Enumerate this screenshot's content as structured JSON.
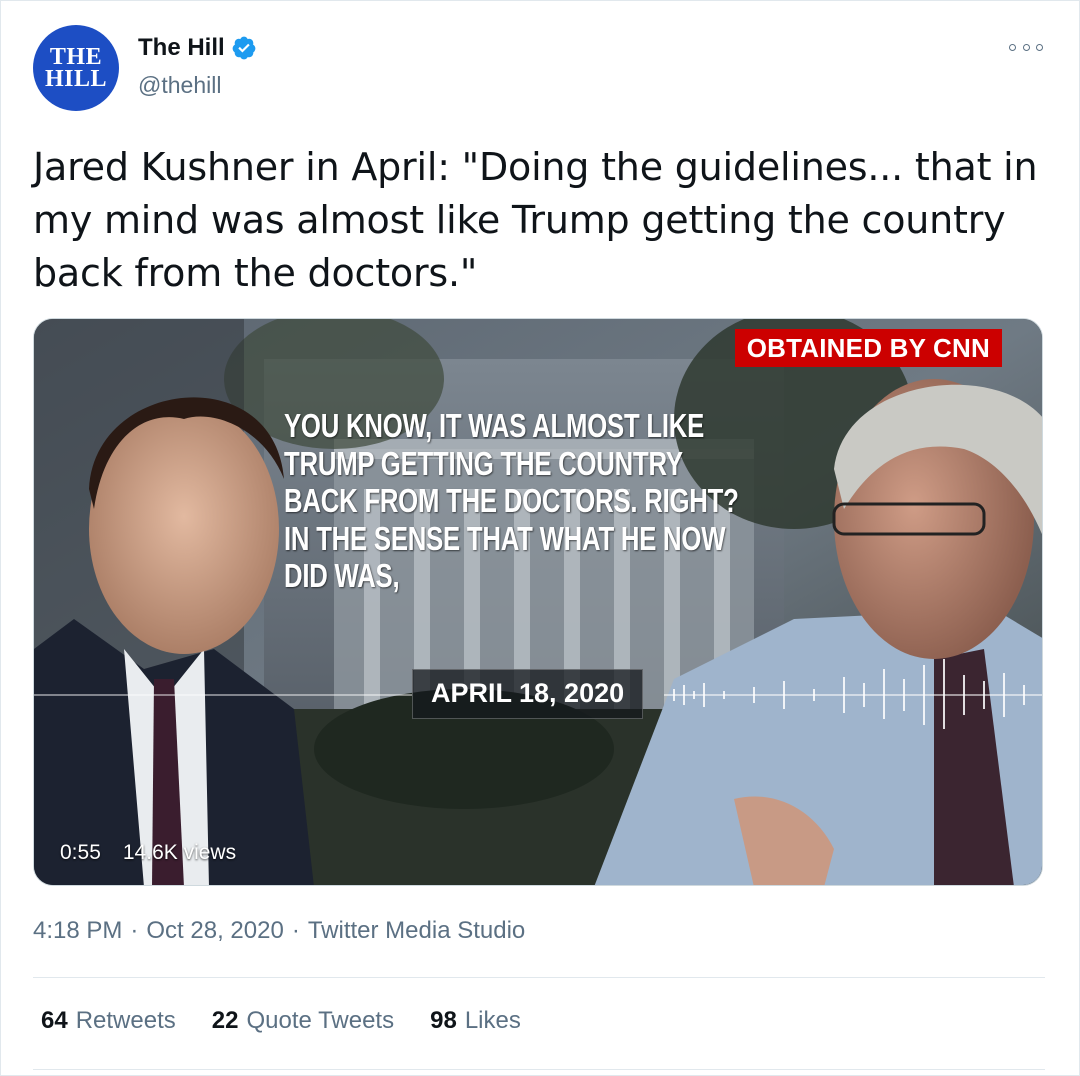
{
  "author": {
    "avatar_line1": "THE",
    "avatar_line2": "HILL",
    "display_name": "The Hill",
    "handle": "@thehill",
    "verified": true
  },
  "tweet": {
    "text": "Jared Kushner in April: \"Doing the guidelines... that in my mind was almost like Trump getting the country back from the doctors.\""
  },
  "media": {
    "badge": "OBTAINED BY CNN",
    "quote_lines": [
      "YOU KNOW, IT WAS ALMOST LIKE",
      "TRUMP GETTING THE COUNTRY",
      "BACK FROM THE DOCTORS. RIGHT?",
      "IN THE SENSE THAT WHAT HE NOW",
      "DID WAS,"
    ],
    "date_label": "APRIL 18, 2020",
    "duration": "0:55",
    "views": "14.6K views"
  },
  "meta": {
    "time": "4:18 PM",
    "separator": "·",
    "date": "Oct 28, 2020",
    "source": "Twitter Media Studio"
  },
  "stats": {
    "retweets_count": "64",
    "retweets_label": "Retweets",
    "quotes_count": "22",
    "quotes_label": "Quote Tweets",
    "likes_count": "98",
    "likes_label": "Likes"
  },
  "colors": {
    "accent": "#1d9bf0",
    "text_secondary": "#5b7083",
    "cnn_red": "#cc0000",
    "avatar_blue": "#1d4ec4"
  }
}
